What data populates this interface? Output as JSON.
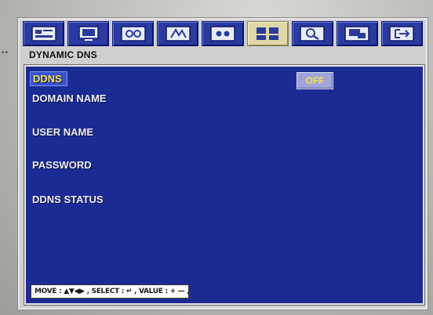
{
  "toolbar": {
    "buttons": [
      {
        "icon": "display-setup-icon",
        "active": false
      },
      {
        "icon": "monitor-icon",
        "active": false
      },
      {
        "icon": "camera-record-icon",
        "active": false
      },
      {
        "icon": "motion-detect-icon",
        "active": false
      },
      {
        "icon": "system-settings-icon",
        "active": false
      },
      {
        "icon": "network-icon",
        "active": true
      },
      {
        "icon": "search-playback-icon",
        "active": false
      },
      {
        "icon": "backup-icon",
        "active": false
      },
      {
        "icon": "exit-icon",
        "active": false
      }
    ]
  },
  "menu": {
    "title": "DYNAMIC DNS",
    "dots": "••"
  },
  "fields": {
    "ddns": "DDNS",
    "domain_name": "DOMAIN NAME",
    "user_name": "USER NAME",
    "password": "PASSWORD",
    "ddns_status": "DDNS STATUS"
  },
  "ddns_value": "OFF",
  "footer": {
    "help": "MOVE : ▲▼◀▶ , SELECT : ↵ , VALUE : + — , PAGE : ◀▶ , ESC : ⇥"
  },
  "colors": {
    "panel": "#1c2b93",
    "highlight": "#f6e24a",
    "active_tab": "#e0d8a6"
  }
}
